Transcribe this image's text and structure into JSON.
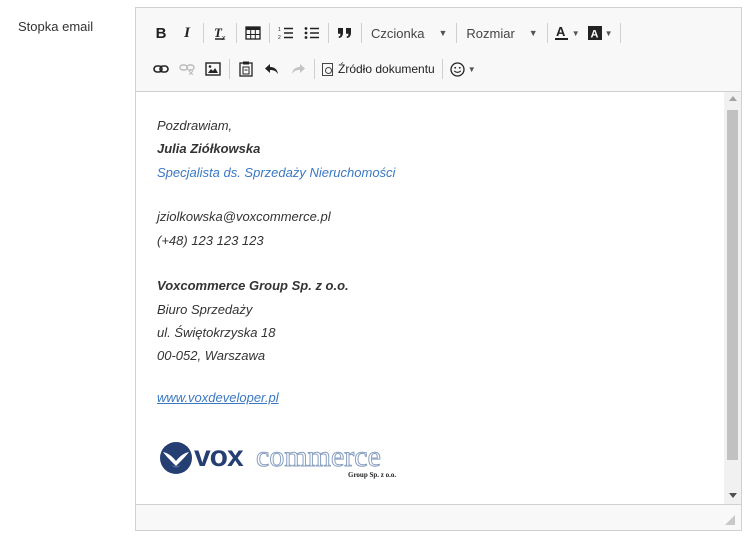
{
  "field": {
    "label": "Stopka email"
  },
  "toolbar": {
    "bold": "B",
    "italic": "I",
    "font_combo": "Czcionka",
    "size_combo": "Rozmiar",
    "source_label": "Źródło dokumentu"
  },
  "signature": {
    "greeting": "Pozdrawiam,",
    "name": "Julia Ziółkowska",
    "position": "Specjalista ds. Sprzedaży Nieruchomości",
    "email": "jziolkowska@voxcommerce.pl",
    "phone": "(+48) 123 123 123",
    "company": "Voxcommerce Group Sp. z o.o.",
    "department": "Biuro Sprzedaży",
    "street": "ul. Świętokrzyska 18",
    "city": "00-052, Warszawa",
    "website": "www.voxdeveloper.pl"
  },
  "logo": {
    "word1": "vox",
    "word2": "commerce",
    "tagline": "Group Sp. z o.o."
  },
  "colors": {
    "link": "#3a78c2",
    "logo_navy": "#263f73"
  }
}
